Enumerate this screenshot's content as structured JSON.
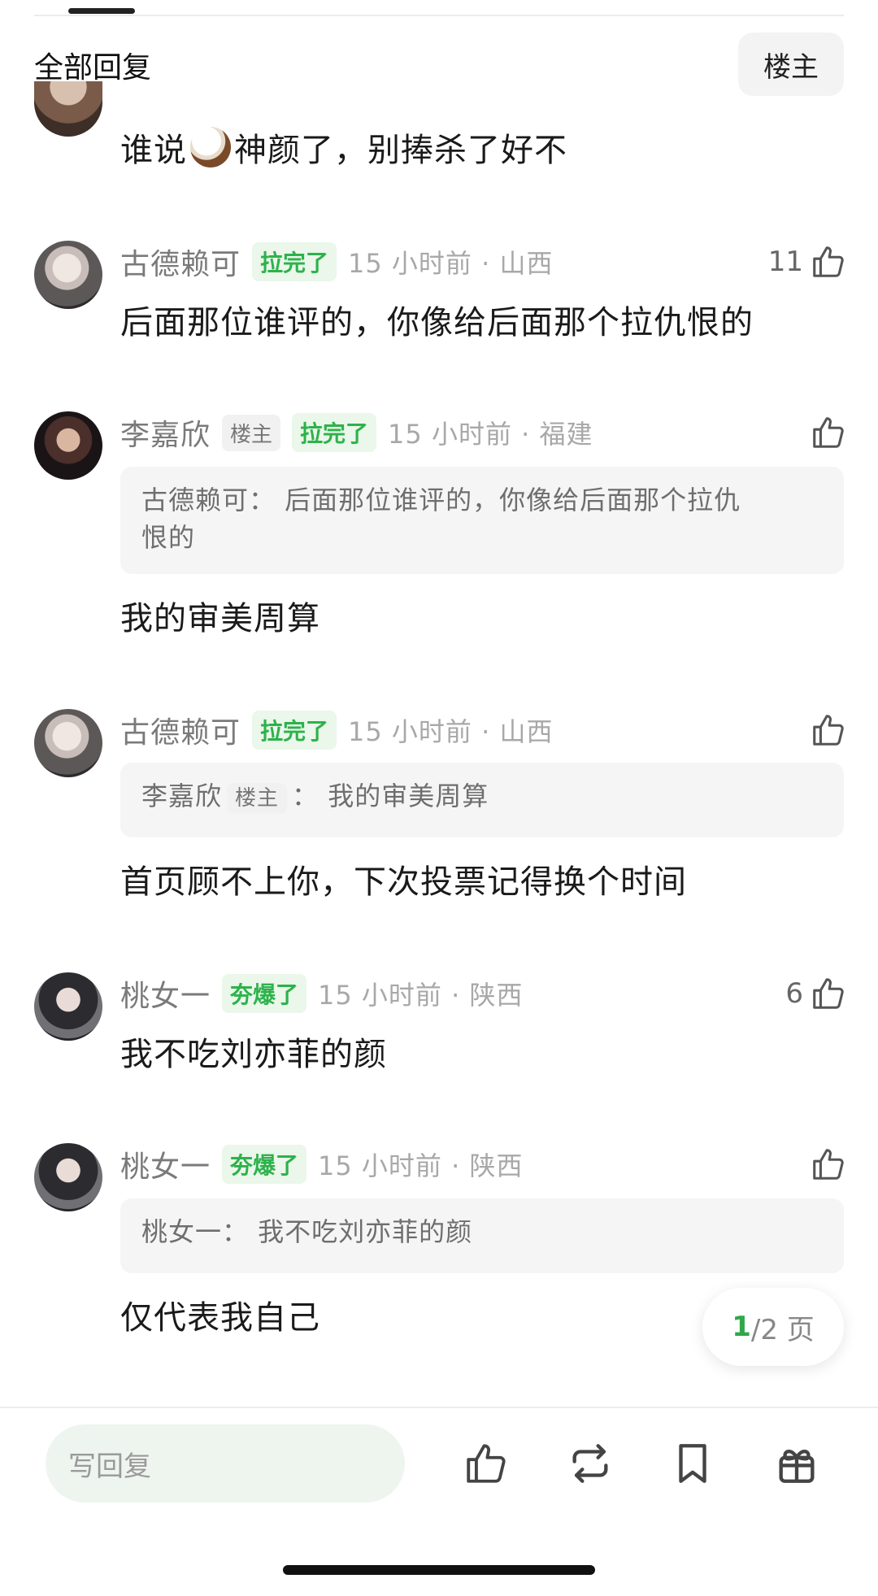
{
  "header": {
    "title": "全部回复",
    "host_button": "楼主"
  },
  "comments": [
    {
      "text_pre": "谁说",
      "text_post": "神颜了，别捧杀了好不"
    },
    {
      "user": "古德赖可",
      "badge": "拉完了",
      "meta": "15 小时前 · 山西",
      "likes": "11",
      "text": "后面那位谁评的，你像给后面那个拉仇恨的"
    },
    {
      "user": "李嘉欣",
      "host_tag": "楼主",
      "badge": "拉完了",
      "meta": "15 小时前 · 福建",
      "likes": "",
      "quote_line1": "古德赖可：  后面那位谁评的，你像给后面那个拉仇",
      "quote_line2": "恨的",
      "text": "我的审美周算"
    },
    {
      "user": "古德赖可",
      "badge": "拉完了",
      "meta": "15 小时前 · 山西",
      "likes": "",
      "quote_user": "李嘉欣",
      "quote_host_tag": "楼主",
      "quote_text": "：  我的审美周算",
      "text": "首页顾不上你，下次投票记得换个时间"
    },
    {
      "user": "桃女一",
      "badge": "夯爆了",
      "meta": "15 小时前 · 陕西",
      "likes": "6",
      "text": "我不吃刘亦菲的颜"
    },
    {
      "user": "桃女一",
      "badge": "夯爆了",
      "meta": "15 小时前 · 陕西",
      "likes": "",
      "quote_text": "桃女一：  我不吃刘亦菲的颜",
      "text": "仅代表我自己"
    }
  ],
  "pagination": {
    "current": "1",
    "rest": "/2 页"
  },
  "bottom_bar": {
    "reply_placeholder": "写回复",
    "icons": [
      "thumbs-up-icon",
      "repost-icon",
      "bookmark-icon",
      "gift-icon"
    ]
  },
  "colors": {
    "green_badge": "#2db24b",
    "green_badge_bg": "#eaf7ea",
    "text_meta": "#a8a8a8"
  }
}
